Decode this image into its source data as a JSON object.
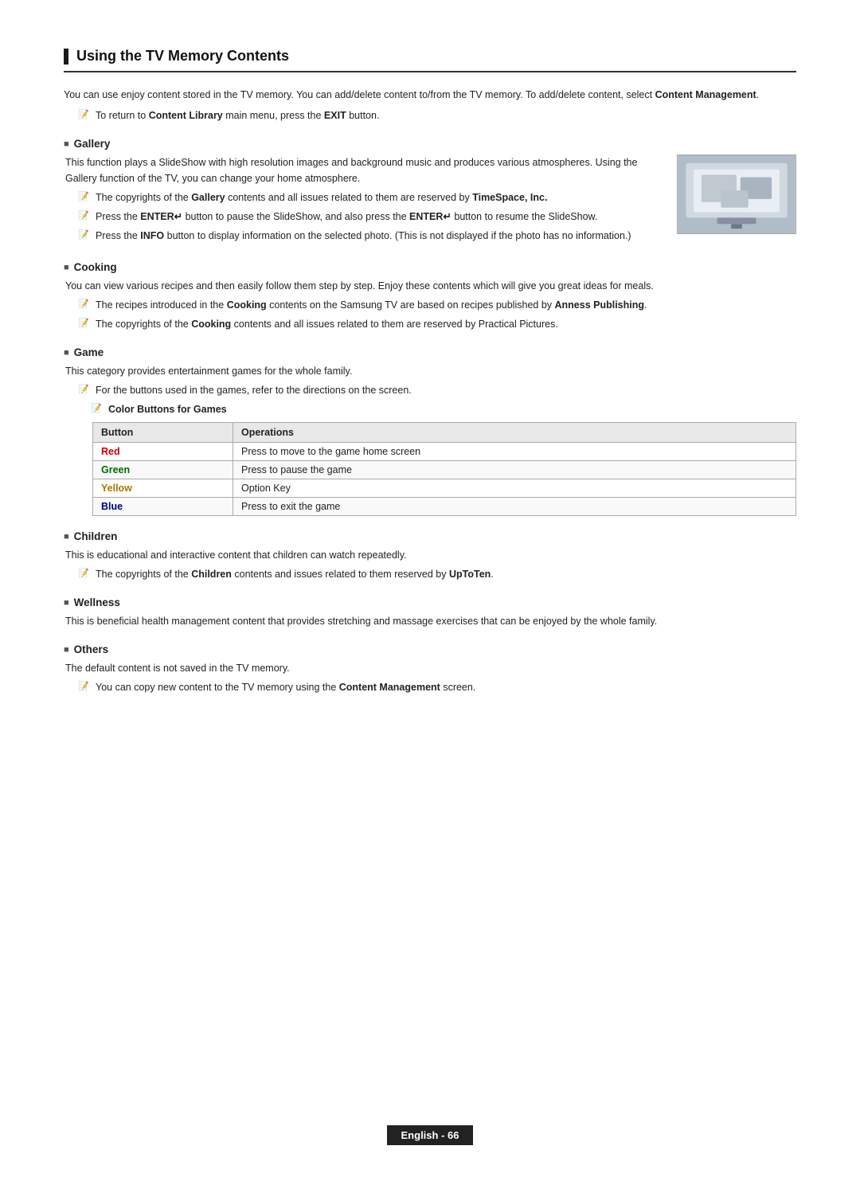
{
  "page": {
    "title": "Using the TV Memory Contents",
    "footer": "English - 66"
  },
  "intro": {
    "line1": "You can use enjoy content stored in the TV memory. You can add/delete content to/from the TV memory. To add/delete content, select Content Management.",
    "note1": "To return to Content Library main menu, press the EXIT button."
  },
  "sections": {
    "gallery": {
      "heading": "Gallery",
      "body": "This function plays a SlideShow with high resolution images and background music and produces various atmospheres. Using the Gallery function of the TV, you can change your home atmosphere.",
      "notes": [
        "The copyrights of the Gallery contents and all issues related to them are reserved by TimeSpace, Inc.",
        "Press the ENTER↵ button to pause the SlideShow, and also press the ENTER↵ button to resume the SlideShow.",
        "Press the INFO button to display information on the selected photo. (This is not displayed if the photo has no information.)"
      ]
    },
    "cooking": {
      "heading": "Cooking",
      "body": "You can view various recipes and then easily follow them step by step. Enjoy these contents which will give you great ideas for meals.",
      "notes": [
        "The recipes introduced in the Cooking contents on the Samsung TV are based on recipes published by Anness Publishing.",
        "The copyrights of the Cooking contents and all issues related to them are reserved by Practical Pictures."
      ]
    },
    "game": {
      "heading": "Game",
      "body": "This category provides entertainment games for the whole family.",
      "notes": [
        "For the buttons used in the games, refer to the directions on the screen."
      ],
      "color_buttons_label": "Color Buttons for Games",
      "table": {
        "headers": [
          "Button",
          "Operations"
        ],
        "rows": [
          {
            "button": "Red",
            "operation": "Press to move to the game home screen"
          },
          {
            "button": "Green",
            "operation": "Press to pause the game"
          },
          {
            "button": "Yellow",
            "operation": "Option Key"
          },
          {
            "button": "Blue",
            "operation": "Press to exit the game"
          }
        ]
      }
    },
    "children": {
      "heading": "Children",
      "body": "This is educational and interactive content that children can watch repeatedly.",
      "notes": [
        "The copyrights of the Children contents and issues related to them reserved by UpToTen."
      ]
    },
    "wellness": {
      "heading": "Wellness",
      "body": "This is beneficial health management content that provides stretching and massage exercises that can be enjoyed by the whole family."
    },
    "others": {
      "heading": "Others",
      "body": "The default content is not saved in the TV memory.",
      "notes": [
        "You can copy new content to the TV memory using the Content Management screen."
      ]
    }
  }
}
